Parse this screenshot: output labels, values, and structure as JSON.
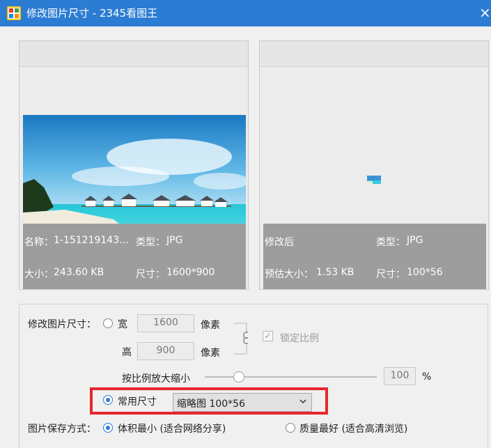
{
  "window": {
    "title": "修改图片尺寸 - 2345看图王",
    "close_icon": "×"
  },
  "original": {
    "name_label": "名称：",
    "name_value": "1-151219143...",
    "type_label": "类型：",
    "type_value": "JPG",
    "size_label": "大小：",
    "size_value": "243.60 KB",
    "dim_label": "尺寸：",
    "dim_value": "1600*900"
  },
  "modified": {
    "caption": "修改后",
    "type_label": "类型：",
    "type_value": "JPG",
    "est_label": "预估大小：",
    "est_value": "1.53 KB",
    "dim_label": "尺寸：",
    "dim_value": "100*56"
  },
  "form": {
    "resize_label": "修改图片尺寸：",
    "width_label": "宽",
    "width_value": "1600",
    "width_unit": "像素",
    "height_label": "高",
    "height_value": "900",
    "height_unit": "像素",
    "lock_label": "锁定比例",
    "lock_checked": true,
    "scale_label": "按比例放大缩小",
    "scale_value": "100",
    "scale_unit": "%",
    "scale_fraction": 0.2,
    "common_label": "常用尺寸",
    "common_selected": "缩略图 100*56",
    "save_mode_label": "图片保存方式：",
    "save_min_label": "体积最小 (适合网络分享)",
    "save_best_label": "质量最好 (适合高清浏览)"
  },
  "colors": {
    "accent": "#2b7cd3",
    "highlight": "#e8262d",
    "info_bar": "#9d9d9d"
  }
}
